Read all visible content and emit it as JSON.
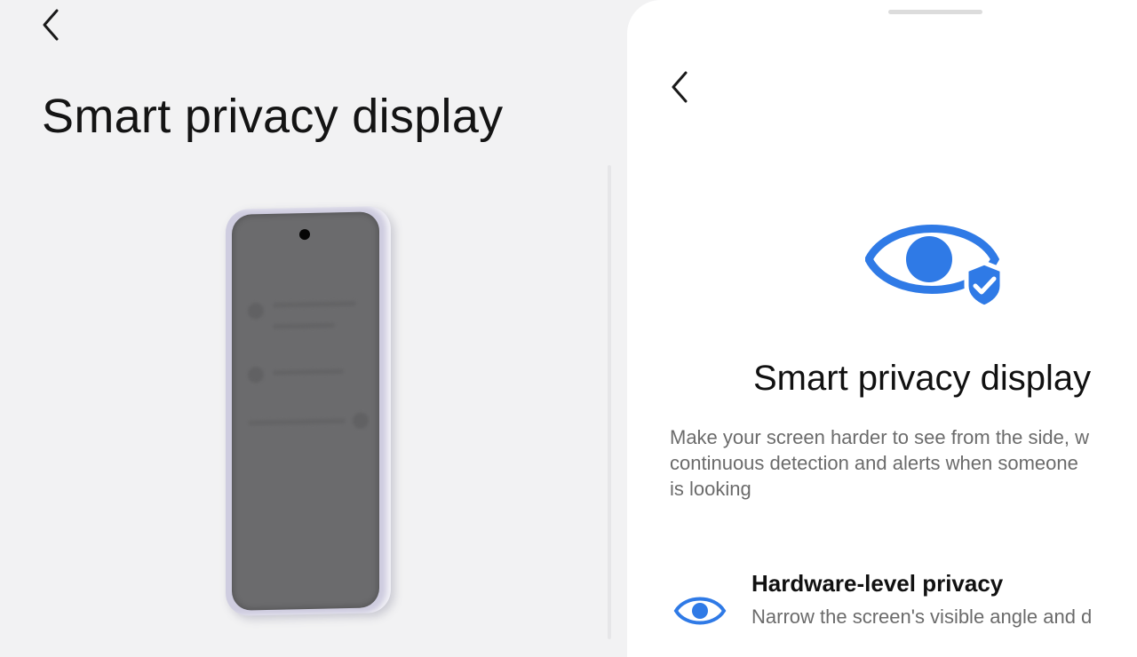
{
  "left": {
    "back_icon": "chevron-left-icon",
    "title": "Smart privacy display"
  },
  "right": {
    "back_icon": "chevron-left-icon",
    "hero_icon": "eye-shield-check-icon",
    "title": "Smart privacy display",
    "description_lines": [
      "Make your screen harder to see from the side, w",
      "continuous detection and alerts when someone",
      "is looking"
    ],
    "feature": {
      "icon": "eye-icon",
      "title": "Hardware-level privacy",
      "description": "Narrow the screen's visible angle and d"
    }
  },
  "colors": {
    "accent": "#2f7ae6",
    "left_background": "#f2f2f3",
    "right_background": "#ffffff",
    "phone_screen": "#6b6b6d"
  }
}
